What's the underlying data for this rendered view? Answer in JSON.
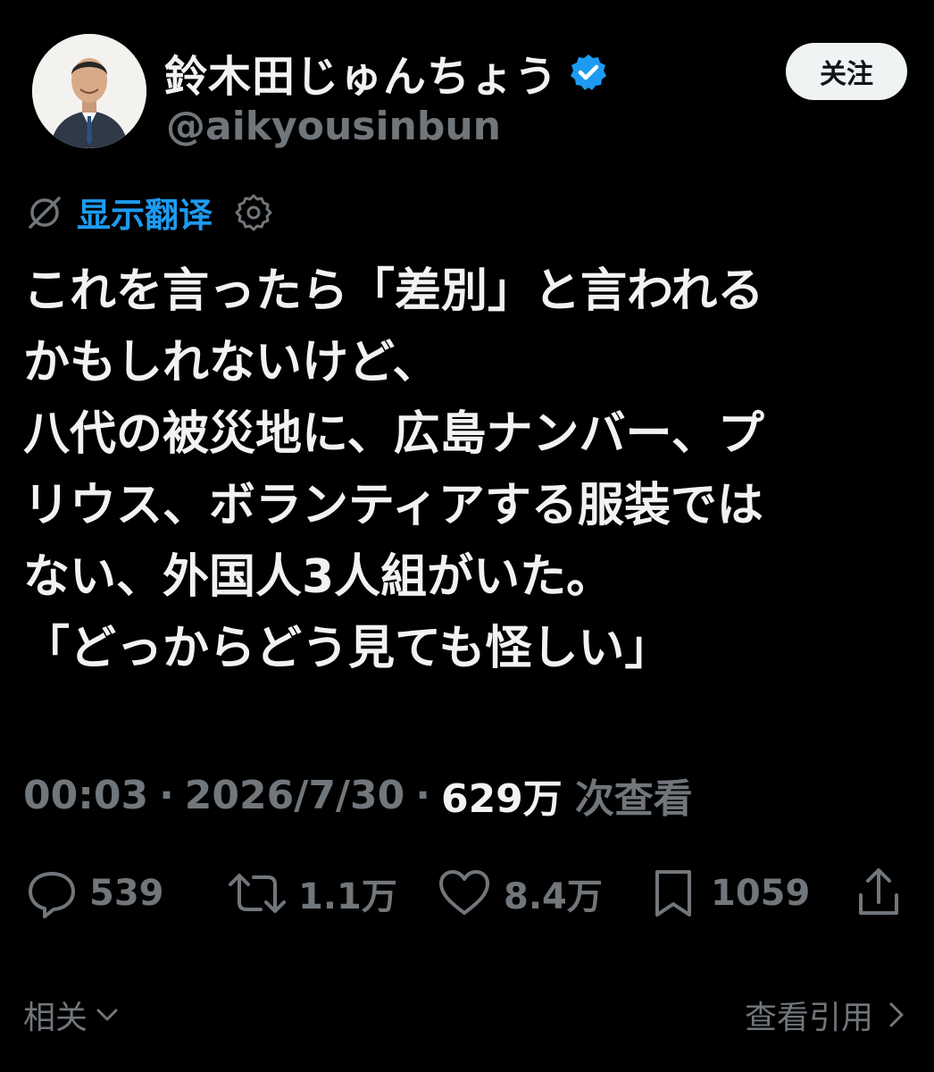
{
  "author": {
    "name": "鈴木田じゅんちょう",
    "handle": "@aikyousinbun",
    "follow_label": "关注"
  },
  "translate": {
    "label": "显示翻译"
  },
  "tweet": {
    "text": "これを言ったら「差別」と言われる\nかもしれないけど、\n八代の被災地に、広島ナンバー、プ\nリウス、ボランティアする服装では\nない、外国人3人組がいた。\n「どっからどう見ても怪しい」"
  },
  "meta": {
    "time": "00:03",
    "sep": "·",
    "date": "2026/7/30",
    "views": "629万",
    "views_label": "次查看"
  },
  "actions": {
    "replies": "539",
    "retweets": "1.1万",
    "likes": "8.4万",
    "bookmarks": "1059"
  },
  "footer": {
    "related_label": "相关",
    "quotes_label": "查看引用"
  },
  "colors": {
    "background": "#000000",
    "accent": "#1d9bf0",
    "muted": "#71767b",
    "text": "#f0f2f3"
  }
}
